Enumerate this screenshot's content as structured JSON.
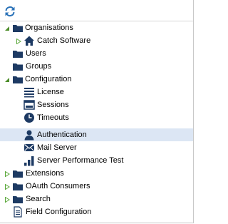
{
  "toolbar": {
    "refresh_icon": "refresh-icon"
  },
  "tree": {
    "organisations": "Organisations",
    "catch_software": "Catch Software",
    "users": "Users",
    "groups": "Groups",
    "configuration": "Configuration",
    "license": "License",
    "sessions": "Sessions",
    "timeouts": "Timeouts",
    "authentication": "Authentication",
    "mail_server": "Mail Server",
    "server_performance_test": "Server Performance Test",
    "extensions": "Extensions",
    "oauth_consumers": "OAuth Consumers",
    "search": "Search",
    "field_configuration": "Field Configuration"
  },
  "selected_item": "Authentication",
  "colors": {
    "folder": "#1d3a63",
    "expanded_arrow": "#4d8d2a",
    "collapsed_arrow": "#5aa83a",
    "refresh": "#2a72b8",
    "selection": "#dce6f4"
  }
}
